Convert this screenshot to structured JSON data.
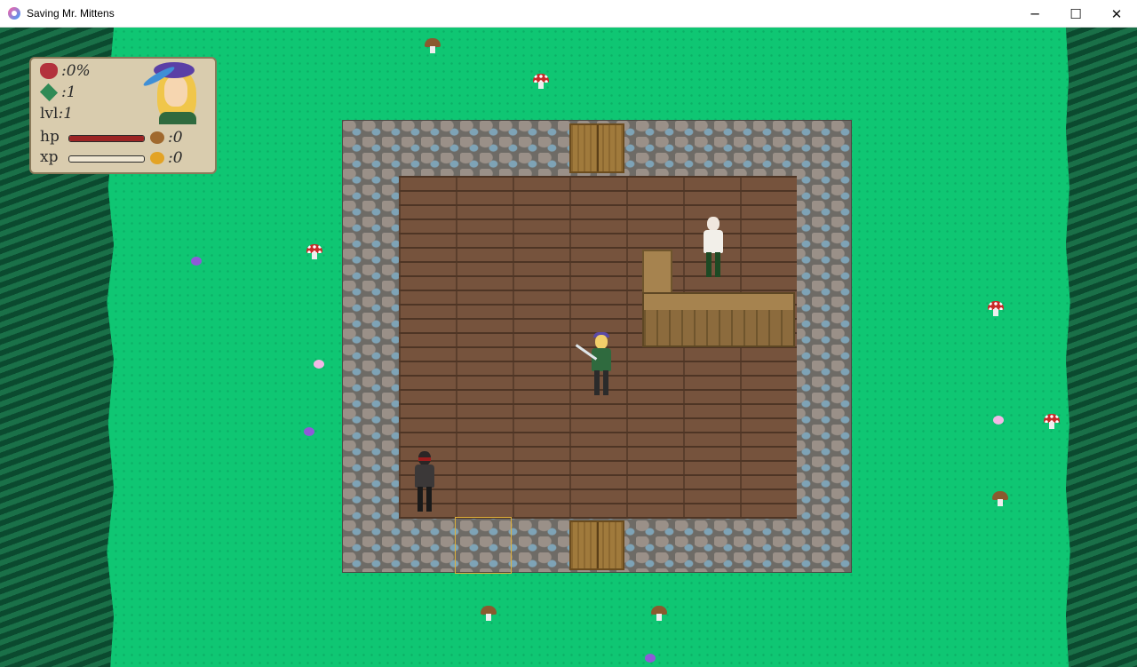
{
  "window": {
    "title": "Saving Mr. Mittens"
  },
  "window_controls": {
    "minimize": "─",
    "maximize": "☐",
    "close": "✕"
  },
  "hud": {
    "corruption": ":0%",
    "gems": ":1",
    "level_label": "lvl",
    "level": ":1",
    "hp_label": "hp",
    "xp_label": "xp",
    "hp_fraction": 1.0,
    "xp_fraction": 0.0,
    "potions": ":0",
    "coins": ":0"
  },
  "icons": {
    "corruption": "demon-icon",
    "gems": "gem-icon",
    "potions": "potion-icon",
    "coins": "coin-icon"
  },
  "colors": {
    "grass": "#0fc673",
    "forest": "#0e5a39",
    "hud_panel": "#d9ccae",
    "hp_bar": "#9c2424",
    "selection": "#e0b23a"
  }
}
